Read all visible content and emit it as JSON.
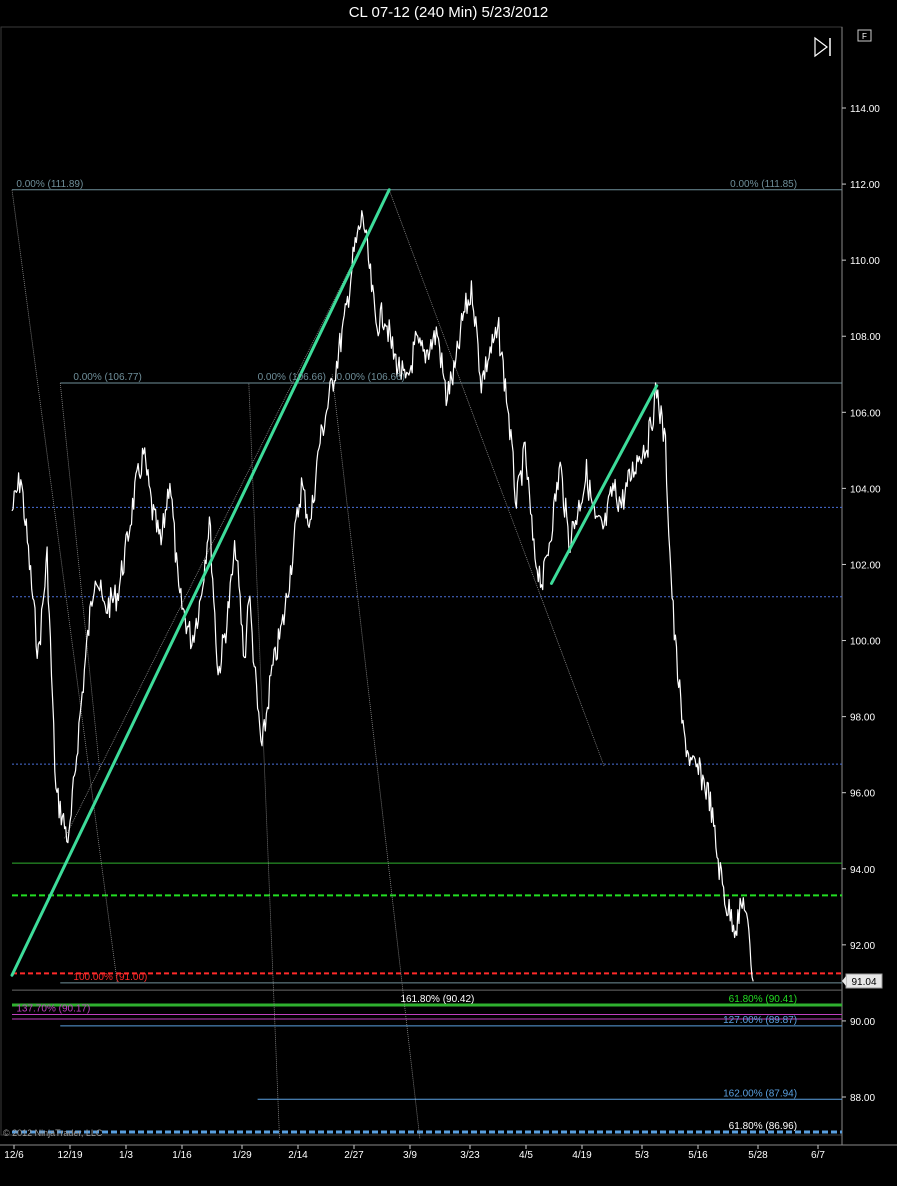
{
  "title": "CL 07-12 (240 Min)  5/23/2012",
  "copyright": "© 2012 NinjaTrader, LLC",
  "toolbar": {
    "f_button": "F",
    "scroll_end_icon": "skip-to-end-icon"
  },
  "colors": {
    "background": "#000000",
    "price": "#ffffff",
    "trend": "#3ddc9a",
    "fib": "#6f8f9a",
    "guide": "#6a6a6a",
    "blue_dash": "#4a6fd8",
    "green_line": "#2fb02f",
    "green_dash": "#22dd22",
    "red_dash": "#ff2a2a",
    "magenta": "#c040c0",
    "light_blue": "#5aa0e0",
    "price_marker_bg": "#e8e8e8"
  },
  "chart_data": {
    "type": "line",
    "title": "CL 07-12 (240 Min)  5/23/2012",
    "instrument": "CL 07-12",
    "interval": "240 Min",
    "date_range": [
      "2011-12-06",
      "2012-06-07"
    ],
    "x_ticks": [
      "12/6",
      "12/19",
      "1/3",
      "1/16",
      "1/29",
      "2/14",
      "2/27",
      "3/9",
      "3/23",
      "4/5",
      "4/19",
      "5/3",
      "5/16",
      "5/28",
      "6/7"
    ],
    "y_ticks": [
      "114.00",
      "112.00",
      "110.00",
      "108.00",
      "106.00",
      "104.00",
      "102.00",
      "100.00",
      "98.00",
      "96.00",
      "94.00",
      "92.00",
      "90.00",
      "88.00"
    ],
    "ylim": [
      86.8,
      114.6
    ],
    "last_price": "91.04",
    "price_series": {
      "name": "",
      "points": [
        [
          "2011-12-06",
          103.4
        ],
        [
          "2011-12-08",
          104.3
        ],
        [
          "2011-12-10",
          102.0
        ],
        [
          "2011-12-12",
          99.6
        ],
        [
          "2011-12-14",
          102.2
        ],
        [
          "2011-12-16",
          96.0
        ],
        [
          "2011-12-19",
          94.7
        ],
        [
          "2011-12-21",
          97.4
        ],
        [
          "2011-12-23",
          99.8
        ],
        [
          "2011-12-25",
          101.9
        ],
        [
          "2011-12-27",
          100.8
        ],
        [
          "2011-12-30",
          101.2
        ],
        [
          "2012-01-01",
          102.4
        ],
        [
          "2012-01-03",
          103.9
        ],
        [
          "2012-01-05",
          104.9
        ],
        [
          "2012-01-07",
          103.4
        ],
        [
          "2012-01-09",
          102.5
        ],
        [
          "2012-01-11",
          104.3
        ],
        [
          "2012-01-13",
          101.2
        ],
        [
          "2012-01-16",
          100.0
        ],
        [
          "2012-01-18",
          101.1
        ],
        [
          "2012-01-20",
          103.2
        ],
        [
          "2012-01-22",
          99.1
        ],
        [
          "2012-01-24",
          100.5
        ],
        [
          "2012-01-26",
          102.5
        ],
        [
          "2012-01-28",
          99.4
        ],
        [
          "2012-01-29",
          101.3
        ],
        [
          "2012-01-31",
          98.2
        ],
        [
          "2012-02-01",
          97.1
        ],
        [
          "2012-02-03",
          99.0
        ],
        [
          "2012-02-06",
          100.6
        ],
        [
          "2012-02-08",
          102.3
        ],
        [
          "2012-02-10",
          104.1
        ],
        [
          "2012-02-12",
          103.0
        ],
        [
          "2012-02-14",
          105.1
        ],
        [
          "2012-02-16",
          106.2
        ],
        [
          "2012-02-18",
          107.3
        ],
        [
          "2012-02-20",
          108.5
        ],
        [
          "2012-02-22",
          110.2
        ],
        [
          "2012-02-24",
          111.2
        ],
        [
          "2012-02-27",
          108.3
        ],
        [
          "2012-02-29",
          108.6
        ],
        [
          "2012-03-02",
          107.5
        ],
        [
          "2012-03-05",
          106.7
        ],
        [
          "2012-03-07",
          107.8
        ],
        [
          "2012-03-09",
          107.5
        ],
        [
          "2012-03-12",
          108.1
        ],
        [
          "2012-03-14",
          106.4
        ],
        [
          "2012-03-16",
          107.1
        ],
        [
          "2012-03-18",
          108.6
        ],
        [
          "2012-03-20",
          109.2
        ],
        [
          "2012-03-22",
          106.8
        ],
        [
          "2012-03-24",
          107.6
        ],
        [
          "2012-03-26",
          108.1
        ],
        [
          "2012-03-28",
          106.2
        ],
        [
          "2012-03-30",
          103.6
        ],
        [
          "2012-04-01",
          105.0
        ],
        [
          "2012-04-03",
          102.3
        ],
        [
          "2012-04-05",
          101.5
        ],
        [
          "2012-04-07",
          103.0
        ],
        [
          "2012-04-09",
          104.6
        ],
        [
          "2012-04-11",
          102.6
        ],
        [
          "2012-04-13",
          103.4
        ],
        [
          "2012-04-15",
          104.4
        ],
        [
          "2012-04-17",
          103.1
        ],
        [
          "2012-04-19",
          102.9
        ],
        [
          "2012-04-21",
          104.0
        ],
        [
          "2012-04-23",
          103.6
        ],
        [
          "2012-04-25",
          104.3
        ],
        [
          "2012-04-27",
          104.9
        ],
        [
          "2012-04-29",
          105.2
        ],
        [
          "2012-05-01",
          106.6
        ],
        [
          "2012-05-03",
          105.1
        ],
        [
          "2012-05-04",
          102.3
        ],
        [
          "2012-05-05",
          100.2
        ],
        [
          "2012-05-07",
          97.6
        ],
        [
          "2012-05-09",
          96.7
        ],
        [
          "2012-05-11",
          96.5
        ],
        [
          "2012-05-13",
          95.9
        ],
        [
          "2012-05-15",
          94.2
        ],
        [
          "2012-05-17",
          93.0
        ],
        [
          "2012-05-19",
          92.5
        ],
        [
          "2012-05-21",
          93.2
        ],
        [
          "2012-05-23",
          91.04
        ]
      ]
    },
    "trend_lines": [
      {
        "from": [
          "2011-12-06",
          91.2
        ],
        "to": [
          "2012-03-01",
          111.85
        ]
      },
      {
        "from": [
          "2012-04-07",
          101.5
        ],
        "to": [
          "2012-05-01",
          106.7
        ]
      }
    ],
    "guide_lines": [
      {
        "from": [
          "2011-12-06",
          111.85
        ],
        "to": [
          "2011-12-30",
          91.0
        ]
      },
      {
        "from": [
          "2011-12-17",
          106.77
        ],
        "to": [
          "2011-12-26",
          96.6
        ]
      },
      {
        "from": [
          "2012-01-29",
          106.75
        ],
        "to": [
          "2012-02-05",
          86.9
        ]
      },
      {
        "from": [
          "2012-02-17",
          107.0
        ],
        "to": [
          "2012-03-08",
          86.9
        ]
      },
      {
        "from": [
          "2012-03-01",
          111.85
        ],
        "to": [
          "2012-04-19",
          96.7
        ]
      },
      {
        "from": [
          "2011-12-18",
          94.8
        ],
        "to": [
          "2012-03-01",
          111.85
        ]
      }
    ],
    "horizontal_levels": [
      {
        "price": 111.85,
        "style": "fib",
        "from": "2011-12-06"
      },
      {
        "price": 106.77,
        "style": "fib",
        "from": "2011-12-17"
      },
      {
        "price": 103.5,
        "style": "blue_dash",
        "from": "2011-12-06"
      },
      {
        "price": 101.15,
        "style": "blue_dash",
        "from": "2011-12-06"
      },
      {
        "price": 96.75,
        "style": "blue_dash",
        "from": "2011-12-06"
      },
      {
        "price": 94.15,
        "style": "green_line",
        "from": "2011-12-06"
      },
      {
        "price": 93.3,
        "style": "green_dash",
        "from": "2011-12-06"
      },
      {
        "price": 91.25,
        "style": "red_dash",
        "from": "2011-12-06"
      },
      {
        "price": 91.0,
        "style": "fib",
        "from": "2011-12-17"
      },
      {
        "price": 90.81,
        "style": "guide",
        "from": "2011-12-06"
      },
      {
        "price": 90.42,
        "style": "green_line",
        "from": "2011-12-06"
      },
      {
        "price": 90.17,
        "style": "magenta",
        "from": "2011-12-06"
      },
      {
        "price": 90.05,
        "style": "magenta",
        "from": "2011-12-06"
      },
      {
        "price": 89.87,
        "style": "light_blue",
        "from": "2011-12-17"
      },
      {
        "price": 87.94,
        "style": "light_blue",
        "from": "2012-01-31"
      },
      {
        "price": 87.08,
        "style": "light_blue_dash",
        "from": "2011-12-06"
      }
    ],
    "annotations": [
      {
        "text": "0.00% (111.89)",
        "at": [
          "2011-12-07",
          111.85
        ],
        "anchor": "start",
        "color": "fib"
      },
      {
        "text": "0.00% (111.85)",
        "at": [
          "2012-06-02",
          111.85
        ],
        "anchor": "end",
        "color": "fib"
      },
      {
        "text": "0.00% (106.77)",
        "at": [
          "2011-12-20",
          106.77
        ],
        "anchor": "start",
        "color": "fib"
      },
      {
        "text": "0.00% (106.66)",
        "at": [
          "2012-01-31",
          106.77
        ],
        "anchor": "start",
        "color": "fib"
      },
      {
        "text": "0.00% (106.66)",
        "at": [
          "2012-02-18",
          106.77
        ],
        "anchor": "start",
        "color": "fib"
      },
      {
        "text": "100.00% (91.00)",
        "at": [
          "2011-12-20",
          91.0
        ],
        "anchor": "start",
        "color": "red_dash"
      },
      {
        "text": "161.80% (90.42)",
        "at": [
          "2012-03-12",
          90.42
        ],
        "anchor": "middle",
        "color": "price"
      },
      {
        "text": "61.80% (90.41)",
        "at": [
          "2012-06-02",
          90.42
        ],
        "anchor": "end",
        "color": "green_dash"
      },
      {
        "text": "137.70% (90.17)",
        "at": [
          "2011-12-07",
          90.17
        ],
        "anchor": "start",
        "color": "magenta"
      },
      {
        "text": "127.00% (89.87)",
        "at": [
          "2012-06-02",
          89.87
        ],
        "anchor": "end",
        "color": "light_blue"
      },
      {
        "text": "162.00% (87.94)",
        "at": [
          "2012-06-02",
          87.94
        ],
        "anchor": "end",
        "color": "light_blue"
      },
      {
        "text": "61.80% (86.96)",
        "at": [
          "2012-06-02",
          87.08
        ],
        "anchor": "end",
        "color": "price"
      }
    ]
  }
}
